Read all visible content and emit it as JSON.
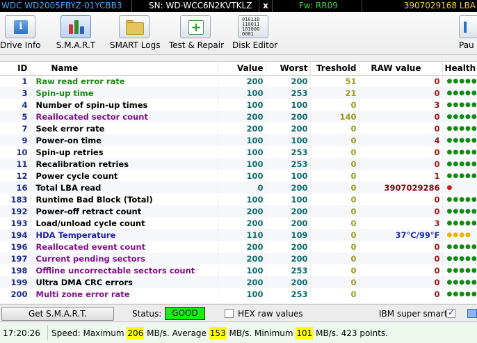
{
  "infobar": {
    "model": "WDC WD2005FBYZ-01YCBB3",
    "serial": "SN: WD-WCC6N2KVTKLZ",
    "close": "x",
    "firmware": "Fw: RR09",
    "lba": "3907029168 LBA"
  },
  "toolbar": {
    "drive_info": "Drive Info",
    "smart": "S.M.A.R.T",
    "smart_logs": "SMART Logs",
    "test_repair": "Test & Repair",
    "disk_editor": "Disk Editor",
    "pause": "Pau",
    "binary_icon_text": "010110\n110011\n101000\n0001"
  },
  "table": {
    "headers": {
      "id": "ID",
      "name": "Name",
      "value": "Value",
      "worst": "Worst",
      "treshold": "Treshold",
      "raw": "RAW value",
      "health": "Health"
    },
    "rows": [
      {
        "id": "1",
        "name": "Raw read error rate",
        "value": "200",
        "worst": "200",
        "treshold": "51",
        "raw": "0",
        "health": "●●●●●"
      },
      {
        "id": "3",
        "name": "Spin-up time",
        "value": "100",
        "worst": "253",
        "treshold": "21",
        "raw": "0",
        "health": "●●●●●"
      },
      {
        "id": "4",
        "name": "Number of spin-up times",
        "value": "100",
        "worst": "100",
        "treshold": "0",
        "raw": "3",
        "health": "●●●●●"
      },
      {
        "id": "5",
        "name": "Reallocated sector count",
        "value": "200",
        "worst": "200",
        "treshold": "140",
        "raw": "0",
        "health": "●●●●●"
      },
      {
        "id": "7",
        "name": "Seek error rate",
        "value": "200",
        "worst": "200",
        "treshold": "0",
        "raw": "0",
        "health": "●●●●●"
      },
      {
        "id": "9",
        "name": "Power-on time",
        "value": "100",
        "worst": "100",
        "treshold": "0",
        "raw": "4",
        "health": "●●●●●"
      },
      {
        "id": "10",
        "name": "Spin-up retries",
        "value": "100",
        "worst": "253",
        "treshold": "0",
        "raw": "0",
        "health": "●●●●●"
      },
      {
        "id": "11",
        "name": "Recalibration retries",
        "value": "100",
        "worst": "253",
        "treshold": "0",
        "raw": "0",
        "health": "●●●●●"
      },
      {
        "id": "12",
        "name": "Power cycle count",
        "value": "100",
        "worst": "100",
        "treshold": "0",
        "raw": "1",
        "health": "●●●●●"
      },
      {
        "id": "16",
        "name": "Total LBA read",
        "value": "0",
        "worst": "200",
        "treshold": "0",
        "raw": "3907029286",
        "health": "●"
      },
      {
        "id": "183",
        "name": "Runtime Bad Block (Total)",
        "value": "100",
        "worst": "100",
        "treshold": "0",
        "raw": "0",
        "health": "●●●●●"
      },
      {
        "id": "192",
        "name": "Power-off retract count",
        "value": "200",
        "worst": "200",
        "treshold": "0",
        "raw": "0",
        "health": "●●●●●"
      },
      {
        "id": "193",
        "name": "Load/unload cycle count",
        "value": "200",
        "worst": "200",
        "treshold": "0",
        "raw": "3",
        "health": "●●●●●"
      },
      {
        "id": "194",
        "name": "HDA Temperature",
        "value": "110",
        "worst": "109",
        "treshold": "0",
        "raw": "37°C/99°F",
        "health": "●●●●"
      },
      {
        "id": "196",
        "name": "Reallocated event count",
        "value": "200",
        "worst": "200",
        "treshold": "0",
        "raw": "0",
        "health": "●●●●●"
      },
      {
        "id": "197",
        "name": "Current pending sectors",
        "value": "200",
        "worst": "200",
        "treshold": "0",
        "raw": "0",
        "health": "●●●●●"
      },
      {
        "id": "198",
        "name": "Offline uncorrectable sectors count",
        "value": "100",
        "worst": "253",
        "treshold": "0",
        "raw": "0",
        "health": "●●●●●"
      },
      {
        "id": "199",
        "name": "Ultra DMA CRC errors",
        "value": "200",
        "worst": "200",
        "treshold": "0",
        "raw": "0",
        "health": "●●●●●"
      },
      {
        "id": "200",
        "name": "Multi zone error rate",
        "value": "100",
        "worst": "253",
        "treshold": "0",
        "raw": "0",
        "health": "●●●●●"
      }
    ]
  },
  "controls": {
    "get_smart": "Get S.M.A.R.T.",
    "status_label": "Status:",
    "status_value": "GOOD",
    "hex_raw": "HEX raw values",
    "ibm_super_smart": "IBM super smart:",
    "ibm_checked": true,
    "hex_checked": false
  },
  "statusline": {
    "time": "17:20:26",
    "speed_prefix": "Speed: Maximum ",
    "max": "206",
    "avg_prefix": " MB/s. Average ",
    "avg": "153",
    "min_prefix": " MB/s. Minimum ",
    "min": "101",
    "suffix": " MB/s. 423 points."
  },
  "colors": {
    "status_good": "#16ef16",
    "model_text": "#3fa8ff",
    "firmware_text": "#37d83a",
    "lba_text": "#f3d12a",
    "highlight": "#ffff00"
  },
  "row_styles": [
    "green",
    "green",
    "default",
    "purple",
    "default",
    "default",
    "default",
    "default",
    "default",
    "default",
    "default",
    "default",
    "default",
    "blue",
    "purple",
    "purple",
    "purple",
    "default",
    "purple"
  ],
  "raw_styles": [
    "red",
    "red",
    "red",
    "red",
    "red",
    "red",
    "red",
    "red",
    "red",
    "dark",
    "red",
    "red",
    "red",
    "blue",
    "red",
    "red",
    "red",
    "red",
    "red"
  ],
  "health_styles": [
    "good",
    "good",
    "good",
    "good",
    "good",
    "good",
    "good",
    "good",
    "good",
    "bad",
    "good",
    "good",
    "good",
    "warn",
    "good",
    "good",
    "good",
    "good",
    "good"
  ]
}
